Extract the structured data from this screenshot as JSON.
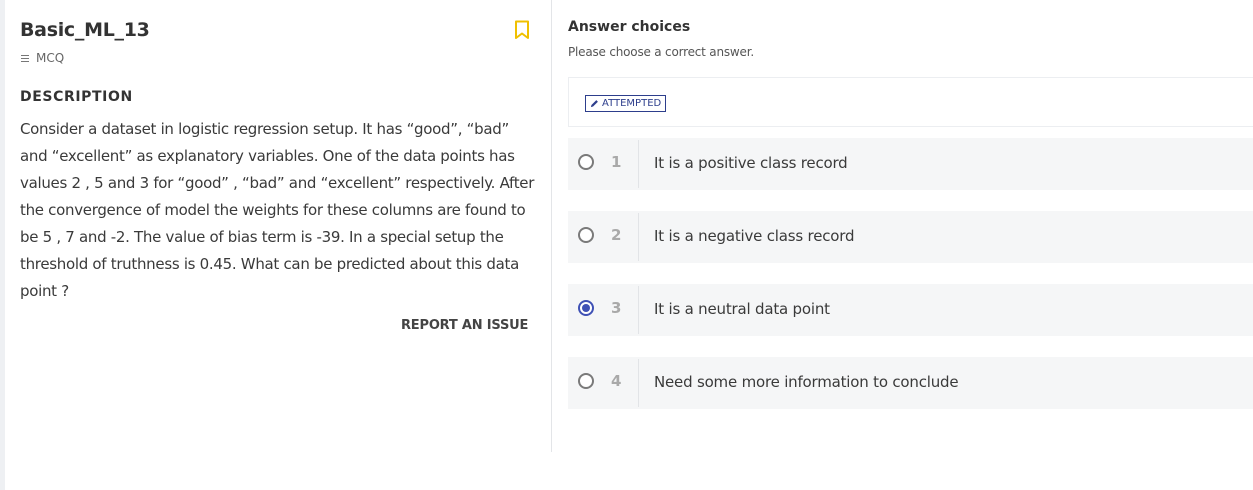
{
  "question": {
    "title": "Basic_ML_13",
    "type_label": "MCQ",
    "description_heading": "DESCRIPTION",
    "description_lines": [
      "Consider a dataset in logistic regression setup. It has “good”, “bad”",
      "and “excellent” as explanatory variables. One of the data points has",
      "values 2 , 5 and 3 for “good”  , “bad” and “excellent” respectively. After",
      "the convergence of model the weights for these columns are found to",
      "be 5 , 7 and -2. The value of bias term is -39. In a special setup the",
      "threshold of truthness is 0.45. What can be predicted about this data",
      "point ?"
    ],
    "report_label": "REPORT AN ISSUE",
    "bookmark_icon": "bookmark-icon",
    "accent_color": "#f0c000"
  },
  "answers": {
    "heading": "Answer choices",
    "subheading": "Please choose a correct answer.",
    "status_badge": "ATTEMPTED",
    "selected_color": "#3f51b5",
    "options": [
      {
        "number": "1",
        "label": "It is a positive class record",
        "selected": false
      },
      {
        "number": "2",
        "label": "It is a negative class record",
        "selected": false
      },
      {
        "number": "3",
        "label": "It is a neutral data point",
        "selected": true
      },
      {
        "number": "4",
        "label": "Need some more information to conclude",
        "selected": false
      }
    ]
  }
}
